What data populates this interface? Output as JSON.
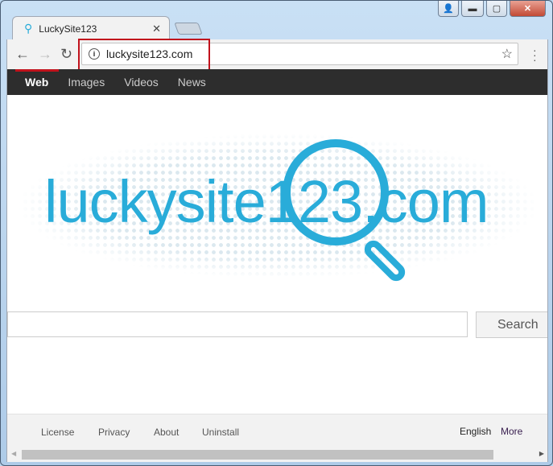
{
  "browser": {
    "tab_title": "LuckySite123",
    "url": "luckysite123.com"
  },
  "nav": {
    "items": [
      "Web",
      "Images",
      "Videos",
      "News"
    ]
  },
  "logo": {
    "text": "luckysite123.com"
  },
  "search": {
    "value": "",
    "button": "Search"
  },
  "footer": {
    "links": [
      "License",
      "Privacy",
      "About",
      "Uninstall"
    ],
    "language": "English",
    "more": "More"
  },
  "colors": {
    "brand": "#29acd9",
    "highlight": "#c1121c"
  }
}
